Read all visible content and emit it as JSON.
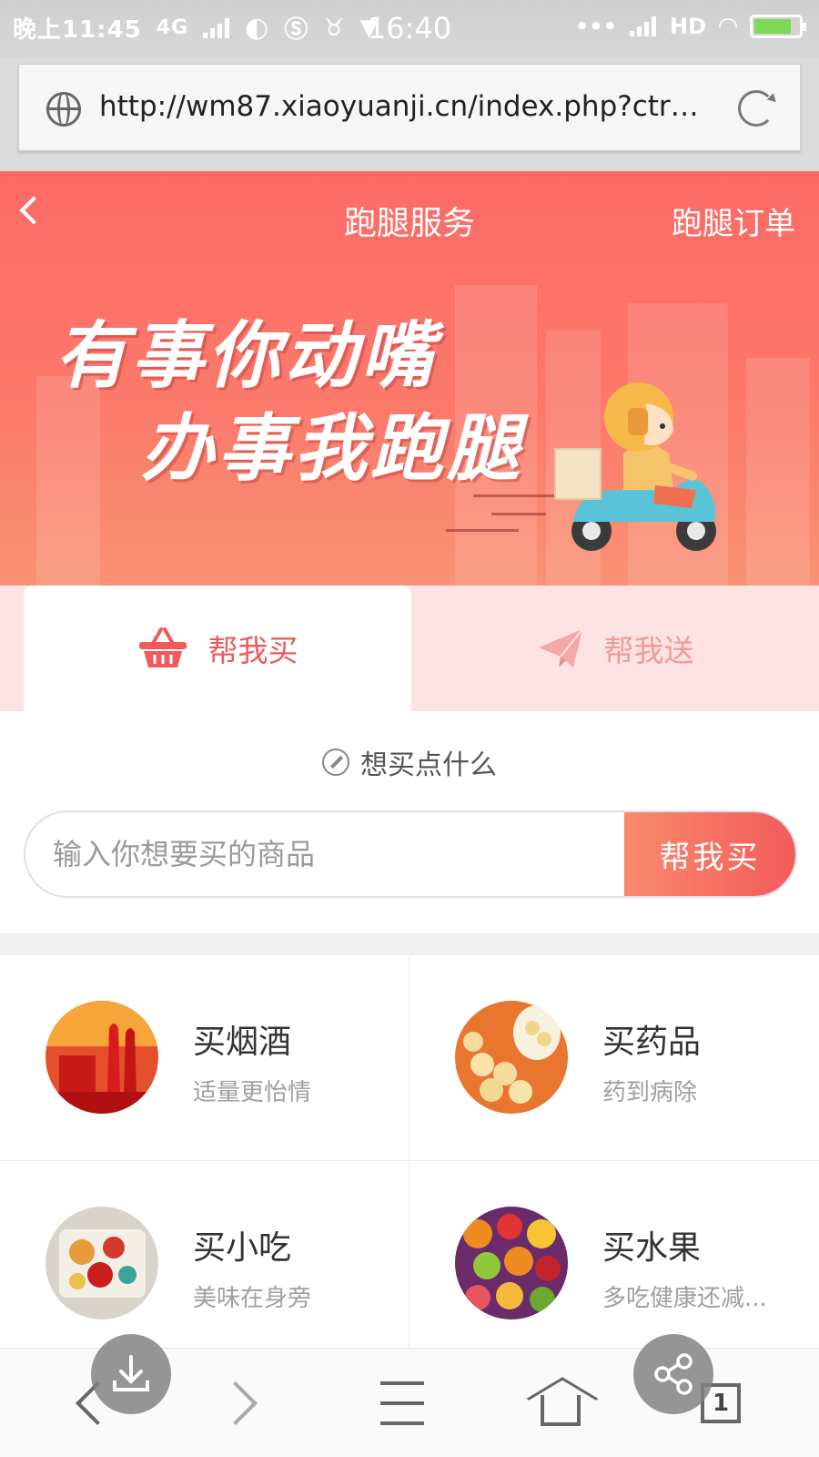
{
  "status_bar": {
    "left_text": "晚上11:45",
    "network": "4G",
    "time": "16:40",
    "hd_label": "HD"
  },
  "browser": {
    "url": "http://wm87.xiaoyuanji.cn/index.php?ctrl..."
  },
  "header": {
    "title": "跑腿服务",
    "orders_link": "跑腿订单"
  },
  "banner": {
    "line1": "有事你动嘴",
    "line2": "办事我跑腿"
  },
  "tabs": [
    {
      "label": "帮我买",
      "icon": "basket-icon",
      "active": true
    },
    {
      "label": "帮我送",
      "icon": "paper-plane-icon",
      "active": false
    }
  ],
  "buy_section": {
    "prompt": "想买点什么",
    "input_placeholder": "输入你想要买的商品",
    "submit_label": "帮我买"
  },
  "categories": [
    {
      "title": "买烟酒",
      "subtitle": "适量更怡情",
      "icon": "liquor-photo"
    },
    {
      "title": "买药品",
      "subtitle": "药到病除",
      "icon": "pills-photo"
    },
    {
      "title": "买小吃",
      "subtitle": "美味在身旁",
      "icon": "snacks-photo"
    },
    {
      "title": "买水果",
      "subtitle": "多吃健康还减...",
      "icon": "fruit-photo"
    }
  ],
  "bottom_nav": {
    "tab_count": "1"
  },
  "colors": {
    "brand": "#f35b5b",
    "brand_light": "#f98a6e",
    "tab_bg": "#fde3e3"
  }
}
